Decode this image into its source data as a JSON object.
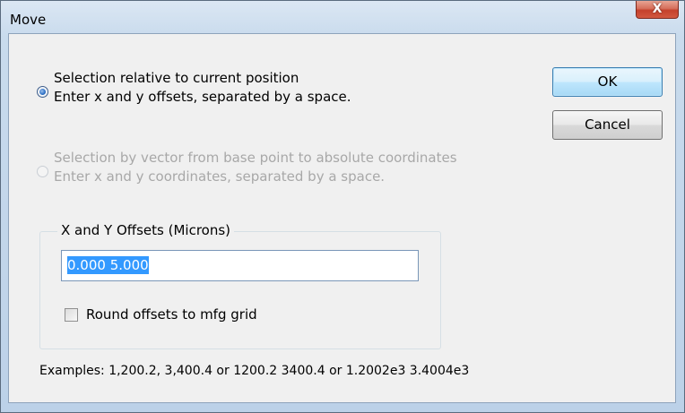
{
  "window": {
    "title": "Move",
    "close_glyph": "X"
  },
  "options": {
    "relative": {
      "label": "Selection relative to current position",
      "hint": "Enter x and y offsets, separated by a space.",
      "checked": true,
      "enabled": true
    },
    "vector": {
      "label": "Selection by vector from base point to absolute coordinates",
      "hint": "Enter x and y coordinates, separated by a space.",
      "checked": false,
      "enabled": false
    }
  },
  "buttons": {
    "ok_label": "OK",
    "cancel_label": "Cancel"
  },
  "offsets_group": {
    "label": "X and Y Offsets (Microns)",
    "input_value": "0.000 5.000",
    "round_label": "Round offsets to mfg grid",
    "round_checked": false
  },
  "examples_text": "Examples: 1,200.2, 3,400.4 or 1200.2 3400.4 or 1.2002e3 3.4004e3",
  "colors": {
    "accent": "#3399ff",
    "disabled_text": "#a8a8a8"
  }
}
